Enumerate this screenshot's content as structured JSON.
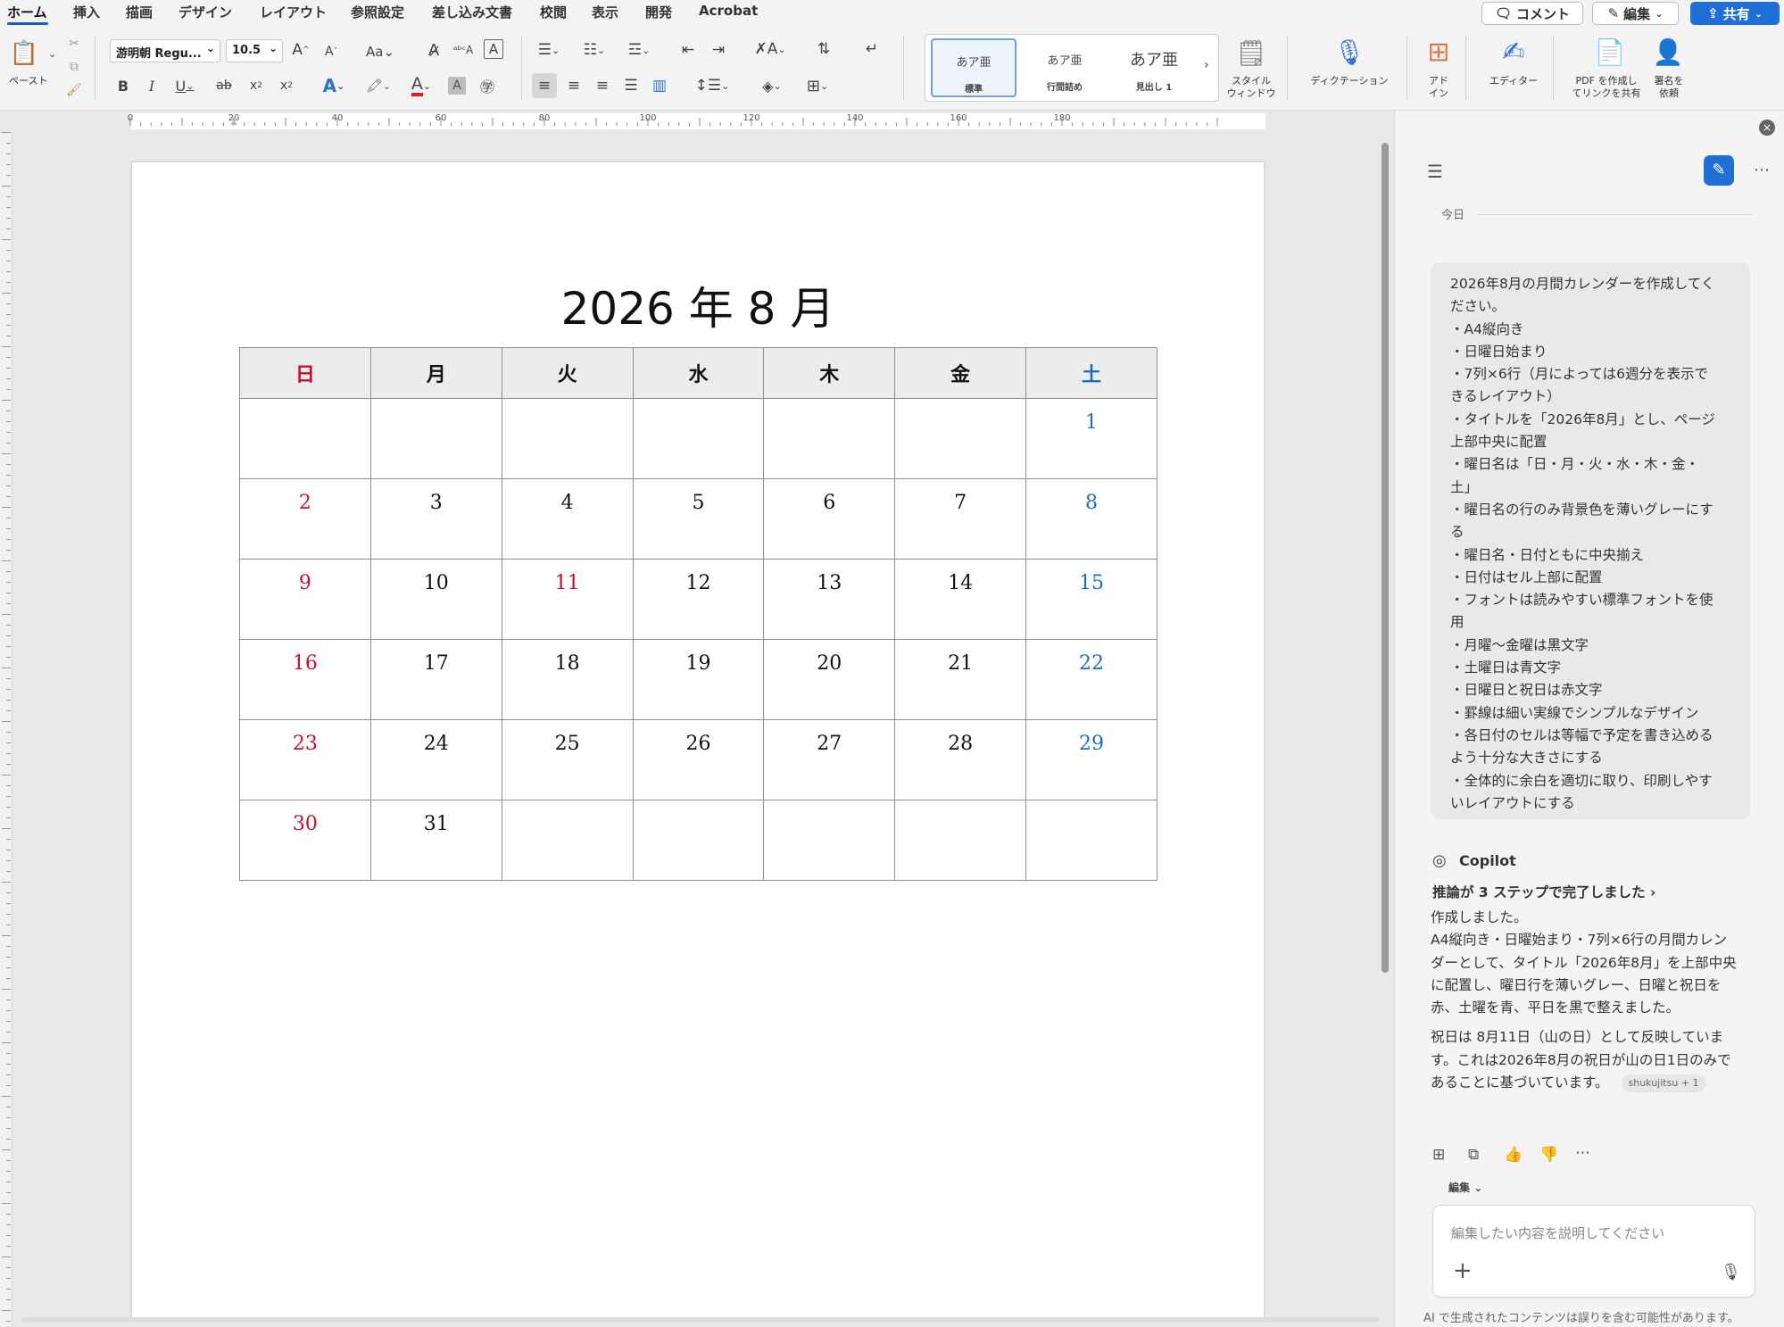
{
  "colors": {
    "accent": "#1f6fd6",
    "sunday_red": "#c8102e",
    "saturday_blue": "#1a6fc0",
    "header_gray": "#ececec"
  },
  "menubar": {
    "tabs": [
      "ホーム",
      "挿入",
      "描画",
      "デザイン",
      "レイアウト",
      "参照設定",
      "差し込み文書",
      "校閲",
      "表示",
      "開発",
      "Acrobat"
    ],
    "comment_label": "コメント",
    "edit_label": "編集",
    "share_label": "共有"
  },
  "ribbon": {
    "paste_label": "ペースト",
    "font_name": "游明朝 Regu...",
    "font_size": "10.5",
    "styles": [
      {
        "sample": "あア亜",
        "name": "標準"
      },
      {
        "sample": "あア亜",
        "name": "行間詰め"
      },
      {
        "sample": "あア亜",
        "name": "見出し 1"
      }
    ],
    "style_window_label": [
      "スタイル",
      "ウィンドウ"
    ],
    "dictation_label": "ディクテーション",
    "addins_label": [
      "アド",
      "イン"
    ],
    "editor_label": "エディター",
    "pdf_share_label": [
      "PDF を作成し",
      "てリンクを共有"
    ],
    "sign_label": [
      "署名を",
      "依頼"
    ]
  },
  "ruler": {
    "marks": [
      "0",
      "20",
      "40",
      "60",
      "80",
      "100",
      "120",
      "140",
      "160",
      "180"
    ]
  },
  "document": {
    "title": "2026 年 8 月",
    "weekdays": [
      "日",
      "月",
      "火",
      "水",
      "木",
      "金",
      "土"
    ],
    "weeks": [
      [
        "",
        "",
        "",
        "",
        "",
        "",
        "1"
      ],
      [
        "2",
        "3",
        "4",
        "5",
        "6",
        "7",
        "8"
      ],
      [
        "9",
        "10",
        "11",
        "12",
        "13",
        "14",
        "15"
      ],
      [
        "16",
        "17",
        "18",
        "19",
        "20",
        "21",
        "22"
      ],
      [
        "23",
        "24",
        "25",
        "26",
        "27",
        "28",
        "29"
      ],
      [
        "30",
        "31",
        "",
        "",
        "",
        "",
        ""
      ]
    ],
    "holidays": [
      "11"
    ]
  },
  "copilot": {
    "date_label": "今日",
    "prompt_lines": [
      "2026年8月の月間カレンダーを作成してく",
      "ださい。",
      "・A4縦向き",
      "・日曜日始まり",
      "・7列×6行（月によっては6週分を表示で",
      "きるレイアウト）",
      "・タイトルを「2026年8月」とし、ページ",
      "上部中央に配置",
      "・曜日名は「日・月・火・水・木・金・",
      "土」",
      "・曜日名の行のみ背景色を薄いグレーにす",
      "る",
      "・曜日名・日付ともに中央揃え",
      "・日付はセル上部に配置",
      "・フォントは読みやすい標準フォントを使",
      "用",
      "・月曜〜金曜は黒文字",
      "・土曜日は青文字",
      "・日曜日と祝日は赤文字",
      "・罫線は細い実線でシンプルなデザイン",
      "・各日付のセルは等幅で予定を書き込める",
      "よう十分な大きさにする",
      "・全体的に余白を適切に取り、印刷しやす",
      "いレイアウトにする"
    ],
    "name": "Copilot",
    "reasoning": "推論が 3 ステップで完了しました",
    "response_lines_1": [
      "作成しました。",
      "A4縦向き・日曜始まり・7列×6行の月間カレン",
      "ダーとして、タイトル「2026年8月」を上部中央",
      "に配置し、曜日行を薄いグレー、日曜と祝日を",
      "赤、土曜を青、平日を黒で整えました。"
    ],
    "response_lines_2": [
      "祝日は 8月11日（山の日）として反映していま",
      "す。これは2026年8月の祝日が山の日1日のみで",
      "あることに基づいています。"
    ],
    "citation": "shukujitsu + 1",
    "mode_label": "編集",
    "input_placeholder": "編集したい内容を説明してください",
    "disclaimer": "AI で生成されたコンテンツは誤りを含む可能性があります。"
  }
}
